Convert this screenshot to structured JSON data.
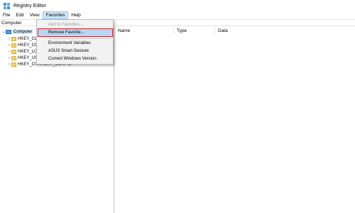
{
  "window": {
    "title": "Registry Editor"
  },
  "menubar": {
    "items": [
      "File",
      "Edit",
      "View",
      "Favorites",
      "Help"
    ]
  },
  "addressbar": {
    "path": "Computer"
  },
  "tree": {
    "root": "Computer",
    "keys": [
      "HKEY_CL",
      "HKEY_CU",
      "HKEY_LC",
      "HKEY_US",
      "HKEY_CURRENT_CONFIG"
    ]
  },
  "list": {
    "columns": [
      "Name",
      "Type",
      "Data"
    ]
  },
  "favorites_menu": {
    "add": "Add to Favorites...",
    "remove": "Remove Favorite...",
    "favorites": [
      "Environment Variables",
      "ASUS Smart Gesture",
      "Current Windows Version"
    ]
  },
  "colors": {
    "highlight_outline": "#d1202a",
    "selection": "#b6d7f2"
  }
}
